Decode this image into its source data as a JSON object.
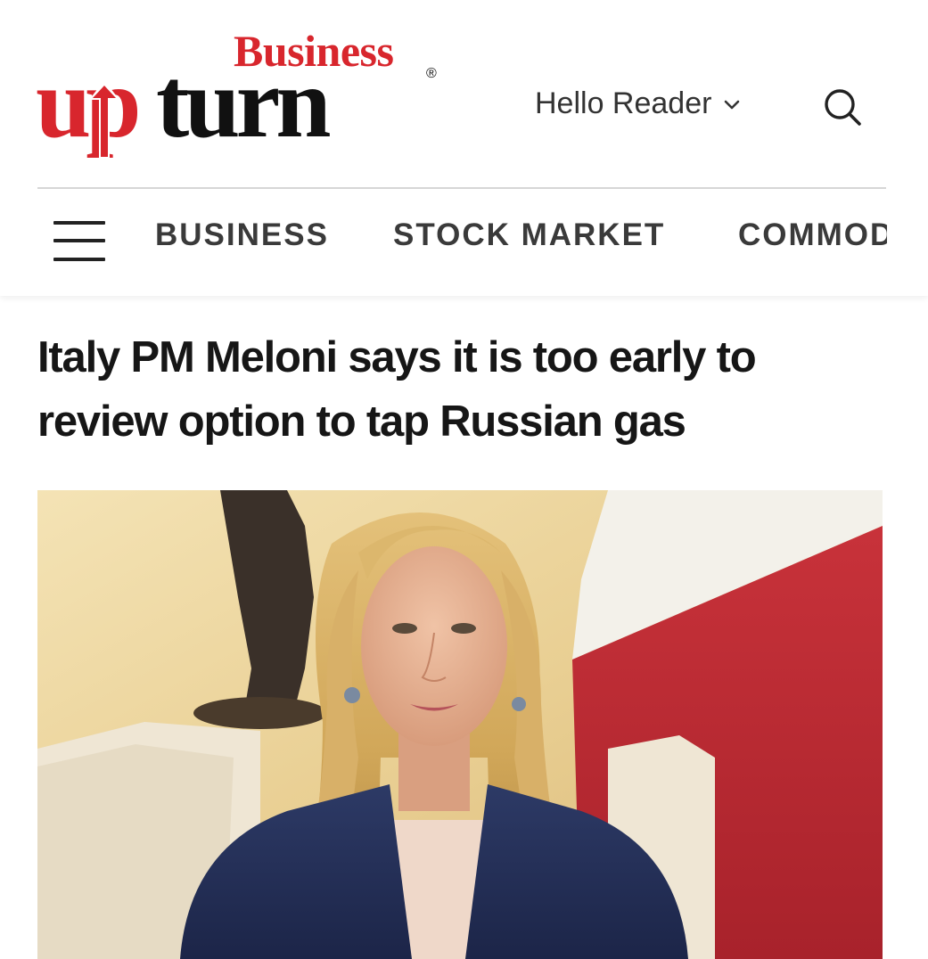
{
  "brand": {
    "business_label": "Business",
    "up_label": "up",
    "turn_label": "turn",
    "registered_mark": "®"
  },
  "header": {
    "greeting": "Hello Reader",
    "greeting_icon": "chevron-down-icon",
    "search_icon": "search-icon",
    "menu_icon": "hamburger-menu-icon"
  },
  "nav": {
    "items": [
      "BUSINESS",
      "STOCK MARKET",
      "COMMODITIES"
    ]
  },
  "article": {
    "headline": "Italy PM Meloni says it is too early to review option to tap Russian gas"
  },
  "colors": {
    "brand_red": "#d8262d",
    "brand_dark": "#111111",
    "nav_text": "#3a3a3a",
    "divider": "#d6d6d6"
  }
}
